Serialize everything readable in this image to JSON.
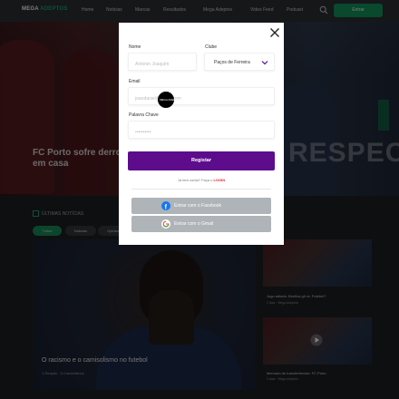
{
  "header": {
    "logo_text": "MEGA ",
    "logo_accent": "ADEPTOS",
    "nav": [
      "Home",
      "Noticias",
      "Marcas",
      "Resultados",
      "Mega Adeptos",
      "Video Feed",
      "Podcast"
    ],
    "join_label": "Entrar"
  },
  "hero": {
    "title": "FC Porto sofre derrota em casa",
    "banner_text": "RESPEC"
  },
  "section": {
    "title": "ÚLTIMAS NOTÍCIAS",
    "pills": [
      "Todas",
      "Noticias",
      "Opiniao"
    ]
  },
  "main_article": {
    "title": "O racismo e o camisolismo no futebol",
    "meta": "1 Reação · 0 Comentários"
  },
  "side_articles": [
    {
      "title": "Jogo adiado: Benfica gil vs. Futebol?",
      "meta": "2 dias · Mega Adeptos"
    },
    {
      "title": "Mercado de transferências: FC Porto",
      "meta": "3 dias · Mega Adeptos"
    }
  ],
  "modal": {
    "name_label": "Nome",
    "name_placeholder": "Antonio Joaquim",
    "club_label": "Clube",
    "club_value": "Paços de Ferreira",
    "email_label": "Email",
    "email_placeholder": "joaodaniel@gmail.com",
    "password_label": "Palavra Chave",
    "password_placeholder": "••••••••••",
    "register_label": "Registar",
    "account_prompt": "Já tem conta? Faça o ",
    "login_label": "LOGIN",
    "facebook_label": "Entrar com o Facebook",
    "gmail_label": "Entrar com o Gmail",
    "cursor_text": "MEGA ADEPTOS"
  },
  "colors": {
    "brand_green": "#1aa36b",
    "register_purple": "#5d0d8c",
    "login_red": "#e0262d",
    "social_grey": "#aeb4b8"
  }
}
